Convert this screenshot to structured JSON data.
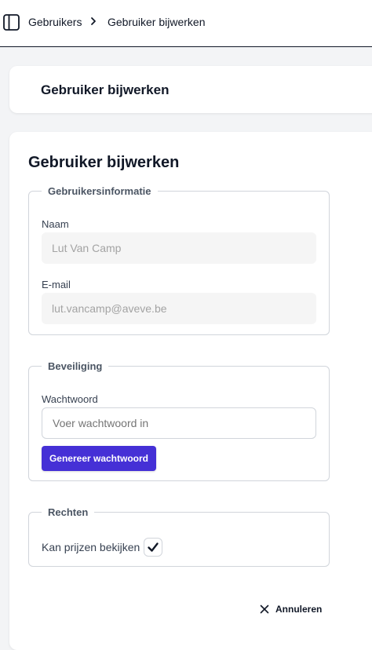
{
  "breadcrumb": {
    "items": [
      "Gebruikers",
      "Gebruiker bijwerken"
    ]
  },
  "header": {
    "title": "Gebruiker bijwerken"
  },
  "form": {
    "title": "Gebruiker bijwerken",
    "user_info": {
      "legend": "Gebruikersinformatie",
      "name_label": "Naam",
      "name_value": "Lut Van Camp",
      "email_label": "E-mail",
      "email_value": "lut.vancamp@aveve.be"
    },
    "security": {
      "legend": "Beveiliging",
      "password_label": "Wachtwoord",
      "password_placeholder": "Voer wachtwoord in",
      "generate_label": "Genereer wachtwoord"
    },
    "rights": {
      "legend": "Rechten",
      "view_prices_label": "Kan prijzen bekijken",
      "view_prices_checked": true
    },
    "cancel_label": "Annuleren"
  },
  "colors": {
    "accent": "#4530d6",
    "background": "#f3f4f6"
  },
  "icons": {
    "sidebar_toggle": "sidebar-toggle-icon",
    "breadcrumb_separator": "chevron-right-icon",
    "checkbox": "checkmark-icon",
    "cancel": "close-icon"
  }
}
